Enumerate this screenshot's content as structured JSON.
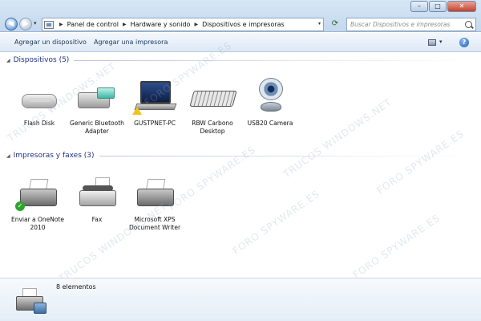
{
  "window": {
    "controls": {
      "minimize": "–",
      "maximize": "□",
      "close": "✕"
    }
  },
  "nav": {
    "back_glyph": "◀",
    "forward_glyph": "▶",
    "history_glyph": "▾"
  },
  "address": {
    "separator": "▶",
    "breadcrumbs": [
      "Panel de control",
      "Hardware y sonido",
      "Dispositivos e impresoras"
    ],
    "dropdown_glyph": "▾",
    "refresh_glyph": "⟳",
    "icon": "control-panel-icon"
  },
  "search": {
    "placeholder": "Buscar Dispositivos e impresoras",
    "icon": "search-icon"
  },
  "toolbar": {
    "add_device": "Agregar un dispositivo",
    "add_printer": "Agregar una impresora",
    "views_dropdown_glyph": "▾",
    "help_glyph": "?"
  },
  "groups": {
    "devices": {
      "arrow": "◢",
      "title": "Dispositivos (5)",
      "items": [
        {
          "label": "Flash Disk",
          "icon": "flash-disk-icon"
        },
        {
          "label": "Generic Bluetooth Adapter",
          "icon": "bluetooth-adapter-icon"
        },
        {
          "label": "GUSTPNET-PC",
          "icon": "laptop-icon",
          "status": "warning"
        },
        {
          "label": "RBW Carbono Desktop",
          "icon": "keyboard-icon"
        },
        {
          "label": "USB20 Camera",
          "icon": "webcam-icon"
        }
      ]
    },
    "printers": {
      "arrow": "◢",
      "title": "Impresoras y faxes (3)",
      "items": [
        {
          "label": "Enviar a OneNote 2010",
          "icon": "printer-icon",
          "status": "default"
        },
        {
          "label": "Fax",
          "icon": "fax-icon"
        },
        {
          "label": "Microsoft XPS Document Writer",
          "icon": "printer-icon"
        }
      ]
    }
  },
  "details": {
    "count": "8 elementos",
    "icon": "devices-printers-icon"
  },
  "status_glyphs": {
    "check": "✓"
  },
  "watermark": {
    "lines": [
      "FORO SPYWARE.ES",
      "TRUCOS WINDOWS.NET"
    ],
    "color": "#9aaac8"
  },
  "colors": {
    "accent": "#1e3287",
    "titlebar": "#c4d8ee",
    "close": "#c4432b"
  }
}
